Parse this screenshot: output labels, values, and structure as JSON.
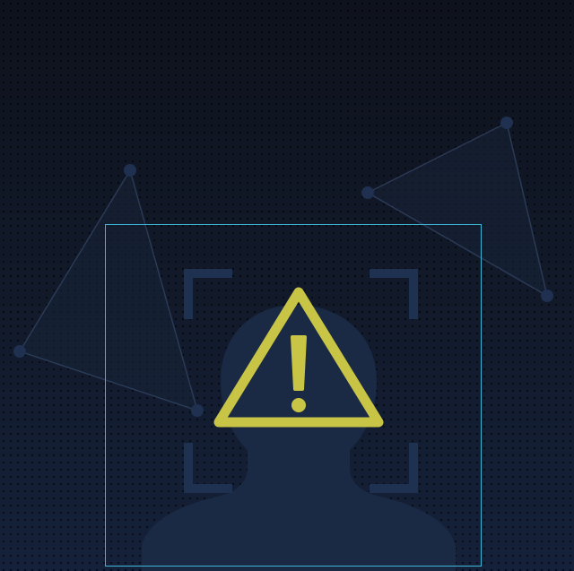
{
  "scene": {
    "icons": {
      "network": "network-graph-icon",
      "person": "person-silhouette-icon",
      "focus": "focus-corners-icon",
      "warning": "warning-triangle-icon"
    },
    "colors": {
      "background": "#111827",
      "frame": "#3fb6d6",
      "warning": "#c8c445",
      "silhouette": "#1a2a44",
      "network_line": "#2a3a56",
      "network_node": "#1f3050"
    }
  }
}
